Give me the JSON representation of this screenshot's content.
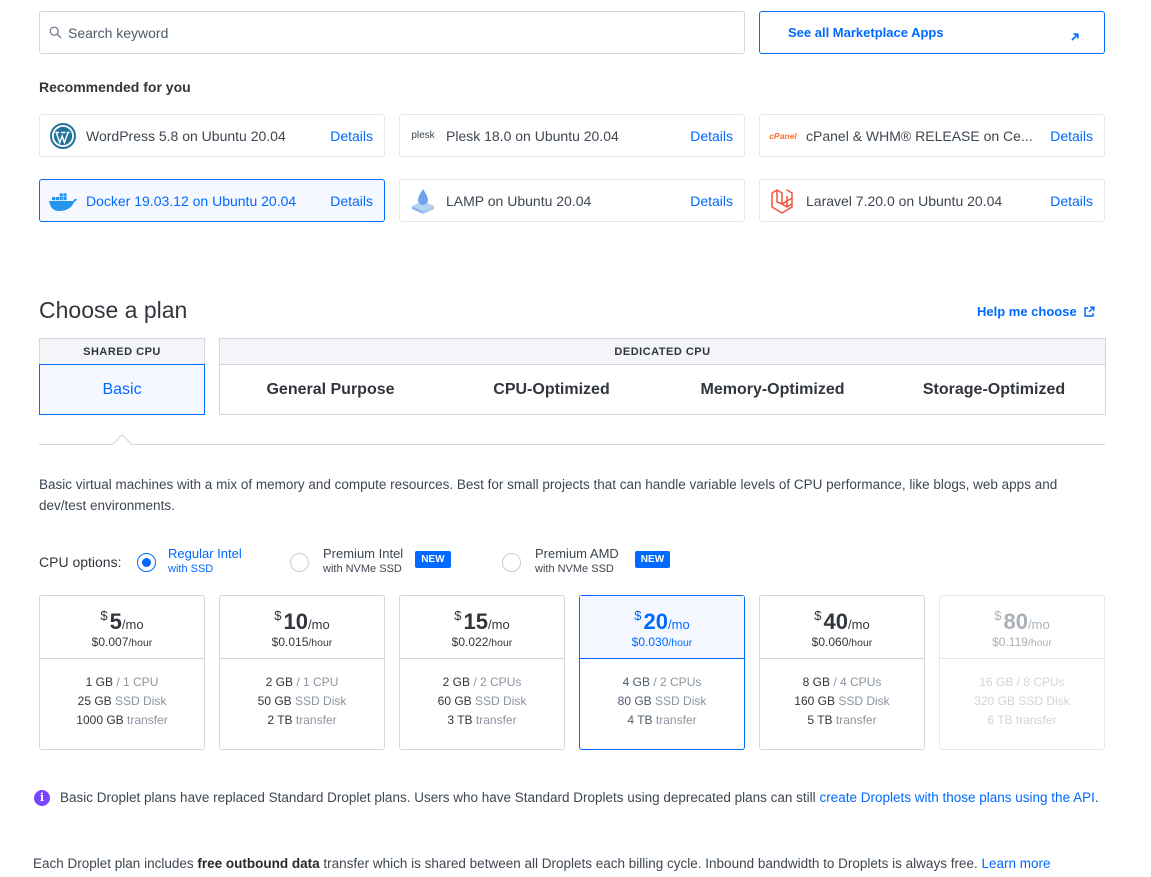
{
  "search": {
    "placeholder": "Search keyword"
  },
  "marketplace_button": {
    "label": "See all Marketplace Apps"
  },
  "recommended": {
    "title": "Recommended for you",
    "apps": [
      {
        "name": "WordPress 5.8 on Ubuntu 20.04",
        "details": "Details",
        "icon": "wordpress-logo"
      },
      {
        "name": "Plesk 18.0 on Ubuntu 20.04",
        "details": "Details",
        "icon": "plesk-logo",
        "logo_text": "plesk"
      },
      {
        "name": "cPanel & WHM® RELEASE on Ce...",
        "details": "Details",
        "icon": "cpanel-logo",
        "logo_text": "cPanel"
      },
      {
        "name": "Docker 19.03.12 on Ubuntu 20.04",
        "details": "Details",
        "icon": "docker-logo",
        "selected": true
      },
      {
        "name": "LAMP on Ubuntu 20.04",
        "details": "Details",
        "icon": "lamp-logo"
      },
      {
        "name": "Laravel 7.20.0 on Ubuntu 20.04",
        "details": "Details",
        "icon": "laravel-logo"
      }
    ]
  },
  "plan": {
    "title": "Choose a plan",
    "help_link": "Help me choose",
    "shared_label": "SHARED CPU",
    "dedicated_label": "DEDICATED CPU",
    "tabs": [
      "Basic",
      "General Purpose",
      "CPU-Optimized",
      "Memory-Optimized",
      "Storage-Optimized"
    ],
    "selected_tab": "Basic",
    "description": "Basic virtual machines with a mix of memory and compute resources. Best for small projects that can handle variable levels of CPU performance, like blogs, web apps and dev/test environments."
  },
  "cpu_options": {
    "label": "CPU options:",
    "options": [
      {
        "main": "Regular Intel",
        "sub": "with SSD",
        "selected": true
      },
      {
        "main": "Premium Intel",
        "sub": "with NVMe SSD",
        "badge": "NEW"
      },
      {
        "main": "Premium AMD",
        "sub": "with NVMe SSD",
        "badge": "NEW"
      }
    ]
  },
  "prices": [
    {
      "currency": "$",
      "amount": "5",
      "per": "/mo",
      "hourly": "$0.007",
      "hour_unit": "/hour",
      "mem": "1 GB",
      "cpu": "/ 1 CPU",
      "disk": "25 GB",
      "disk_unit": "SSD Disk",
      "transfer": "1000 GB",
      "transfer_unit": "transfer"
    },
    {
      "currency": "$",
      "amount": "10",
      "per": "/mo",
      "hourly": "$0.015",
      "hour_unit": "/hour",
      "mem": "2 GB",
      "cpu": "/ 1 CPU",
      "disk": "50 GB",
      "disk_unit": "SSD Disk",
      "transfer": "2 TB",
      "transfer_unit": "transfer"
    },
    {
      "currency": "$",
      "amount": "15",
      "per": "/mo",
      "hourly": "$0.022",
      "hour_unit": "/hour",
      "mem": "2 GB",
      "cpu": "/ 2 CPUs",
      "disk": "60 GB",
      "disk_unit": "SSD Disk",
      "transfer": "3 TB",
      "transfer_unit": "transfer"
    },
    {
      "currency": "$",
      "amount": "20",
      "per": "/mo",
      "hourly": "$0.030",
      "hour_unit": "/hour",
      "mem": "4 GB",
      "cpu": "/ 2 CPUs",
      "disk": "80 GB",
      "disk_unit": "SSD Disk",
      "transfer": "4 TB",
      "transfer_unit": "transfer",
      "selected": true
    },
    {
      "currency": "$",
      "amount": "40",
      "per": "/mo",
      "hourly": "$0.060",
      "hour_unit": "/hour",
      "mem": "8 GB",
      "cpu": "/ 4 CPUs",
      "disk": "160 GB",
      "disk_unit": "SSD Disk",
      "transfer": "5 TB",
      "transfer_unit": "transfer"
    },
    {
      "currency": "$",
      "amount": "80",
      "per": "/mo",
      "hourly": "$0.119",
      "hour_unit": "/hour",
      "mem": "16 GB",
      "cpu": "/ 8 CPUs",
      "disk": "320 GB",
      "disk_unit": "SSD Disk",
      "transfer": "6 TB",
      "transfer_unit": "transfer",
      "disabled": true
    }
  ],
  "info": {
    "text": "Basic Droplet plans have replaced Standard Droplet plans. Users who have Standard Droplets using deprecated plans can still ",
    "link": "create Droplets with those plans using the API",
    "end": "."
  },
  "footer": {
    "pre": "Each Droplet plan includes ",
    "bold": "free outbound data",
    "post": " transfer which is shared between all Droplets each billing cycle. Inbound bandwidth to Droplets is always free. ",
    "link": "Learn more"
  },
  "colors": {
    "accent": "#0069ff",
    "info_icon": "#7a43ff"
  }
}
